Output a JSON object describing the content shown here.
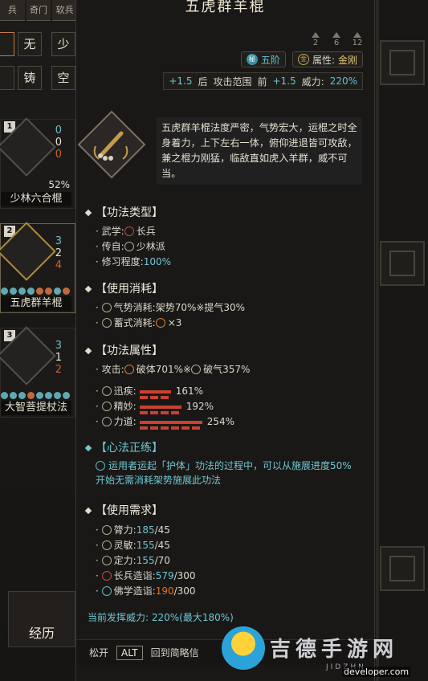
{
  "left_tabs": [
    "兵",
    "奇门",
    "软兵"
  ],
  "grid_chars": [
    "",
    "无",
    "少",
    "",
    "铸",
    "空"
  ],
  "skills": [
    {
      "level": "1",
      "nums": [
        "0",
        "0",
        "0"
      ],
      "progress_pct": "52%",
      "name": "少林六合棍"
    },
    {
      "level": "2",
      "nums": [
        "3",
        "2",
        "4"
      ],
      "name": "五虎群羊棍"
    },
    {
      "level": "3",
      "nums": [
        "3",
        "1",
        "2"
      ],
      "name": "大智菩提杖法"
    }
  ],
  "jingli_label": "经历",
  "tooltip": {
    "title": "五虎群羊棍",
    "tiers": [
      "2",
      "6",
      "12"
    ],
    "rank_badge": "秘",
    "rank_text": "五阶",
    "attr_badge": "金",
    "attr_label": "属性:",
    "attr_value": "金刚",
    "range": {
      "back_val": "+1.5",
      "back": "后",
      "label": "攻击范围",
      "front": "前",
      "front_val": "+1.5",
      "power_label": "威力:",
      "power_val": "220%"
    },
    "description": "五虎群羊棍法度严密，气势宏大，运棍之时全身着力，上下左右一体，俯仰进退皆可攻敌，兼之棍力刚猛，临敌直如虎入羊群，威不可当。",
    "sections": {
      "type": {
        "title": "【功法类型】",
        "wuxue_label": "武学:",
        "wuxue_val": "长兵",
        "chuanzi_label": "传自:",
        "chuanzi_val": "少林派",
        "xiuxi_label": "修习程度:",
        "xiuxi_val": "100%"
      },
      "cost": {
        "title": "【使用消耗】",
        "qishi_label": "气势消耗:",
        "qishi_val": "架势70%※提气30%",
        "xushi_label": "蓄式消耗:",
        "xushi_val": "×3"
      },
      "attr": {
        "title": "【功法属性】",
        "atk_label": "攻击:",
        "atk_val1": "破体701%※",
        "atk_val2": "破气357%",
        "xunji_label": "迅疾:",
        "xunji_val": "161%",
        "jingmiao_label": "精妙:",
        "jingmiao_val": "192%",
        "lidao_label": "力道:",
        "lidao_val": "254%"
      },
      "xinfa": {
        "title": "【心法正练】",
        "text": "运用者运起「护体」功法的过程中，可以从施展进度50%开始无需消耗架势施展此功法"
      },
      "req": {
        "title": "【使用需求】",
        "items": [
          {
            "label": "膂力:",
            "cur": "185",
            "max": "/45"
          },
          {
            "label": "灵敏:",
            "cur": "155",
            "max": "/45"
          },
          {
            "label": "定力:",
            "cur": "155",
            "max": "/70"
          },
          {
            "label": "长兵造诣:",
            "cur": "579",
            "max": "/300"
          },
          {
            "label": "佛学造诣:",
            "cur": "190",
            "max": "/300"
          }
        ]
      }
    },
    "current_power": "当前发挥威力: 220%(最大180%)",
    "bottom": {
      "release": "松开",
      "key": "ALT",
      "return": "回到简略信"
    }
  },
  "watermark": {
    "text": "吉德手游网",
    "pinyin": "JIDZHN",
    "url": "developer.com"
  },
  "colors": {
    "teal": "#6fc8d4",
    "orange": "#e3701e",
    "red_bar": "#c9422f"
  }
}
